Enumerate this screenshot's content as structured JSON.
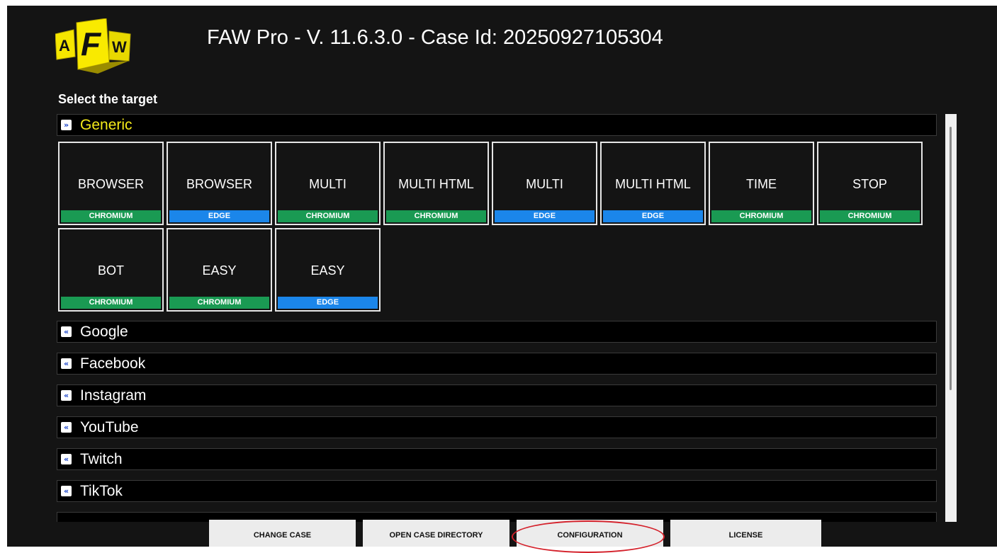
{
  "app": {
    "title": "FAW Pro - V. 11.6.3.0 - Case Id: 20250927105304",
    "logo_letters": [
      "A",
      "F",
      "W"
    ]
  },
  "subtitle": "Select the target",
  "sections": [
    {
      "label": "Generic",
      "expanded": true,
      "icon": "chevron-double-down-icon"
    },
    {
      "label": "Google",
      "expanded": false,
      "icon": "chevron-double-up-icon"
    },
    {
      "label": "Facebook",
      "expanded": false,
      "icon": "chevron-double-up-icon"
    },
    {
      "label": "Instagram",
      "expanded": false,
      "icon": "chevron-double-up-icon"
    },
    {
      "label": "YouTube",
      "expanded": false,
      "icon": "chevron-double-up-icon"
    },
    {
      "label": "Twitch",
      "expanded": false,
      "icon": "chevron-double-up-icon"
    },
    {
      "label": "TikTok",
      "expanded": false,
      "icon": "chevron-double-up-icon"
    }
  ],
  "generic_tiles": [
    {
      "name": "BROWSER",
      "engine": "CHROMIUM"
    },
    {
      "name": "BROWSER",
      "engine": "EDGE"
    },
    {
      "name": "MULTI",
      "engine": "CHROMIUM"
    },
    {
      "name": "MULTI HTML",
      "engine": "CHROMIUM"
    },
    {
      "name": "MULTI",
      "engine": "EDGE"
    },
    {
      "name": "MULTI HTML",
      "engine": "EDGE"
    },
    {
      "name": "TIME",
      "engine": "CHROMIUM"
    },
    {
      "name": "STOP",
      "engine": "CHROMIUM"
    },
    {
      "name": "BOT",
      "engine": "CHROMIUM"
    },
    {
      "name": "EASY",
      "engine": "CHROMIUM"
    },
    {
      "name": "EASY",
      "engine": "EDGE"
    }
  ],
  "footer": {
    "change_case": "CHANGE CASE",
    "open_case_directory": "OPEN CASE DIRECTORY",
    "configuration": "CONFIGURATION",
    "license": "LICENSE"
  },
  "colors": {
    "background": "#141414",
    "active_section": "#f5ea1a",
    "chromium": "#1a9a53",
    "edge": "#1b86ea",
    "highlight": "#d4202a"
  }
}
